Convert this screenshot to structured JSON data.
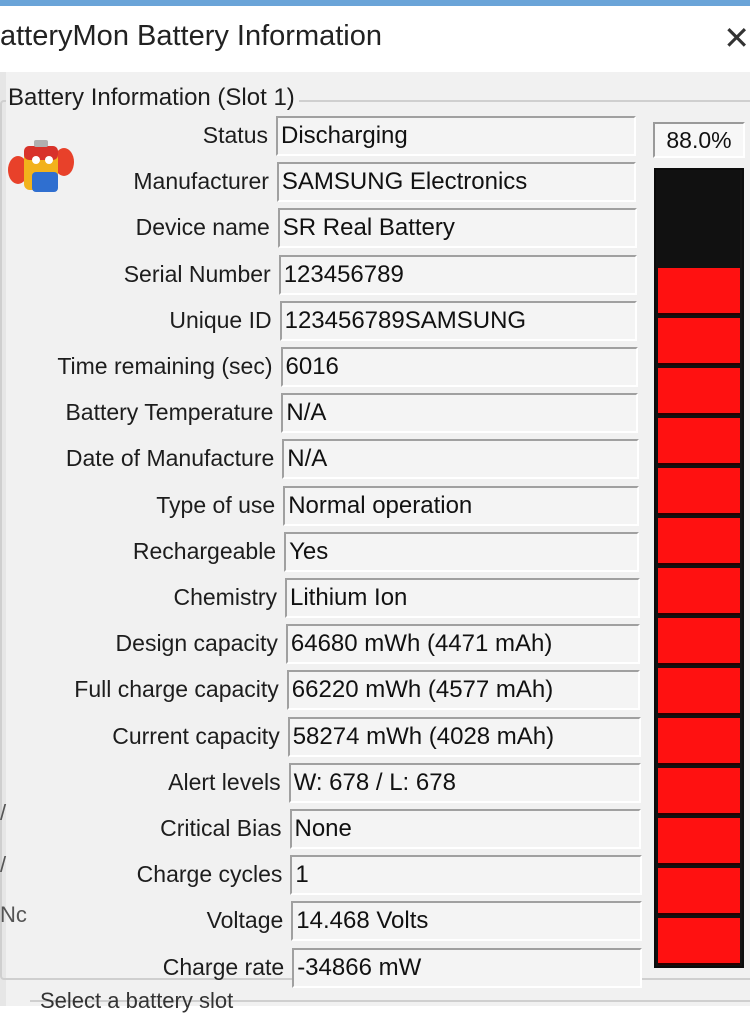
{
  "window": {
    "title": "atteryMon Battery Information",
    "close_glyph": "✕"
  },
  "group": {
    "label": "Battery Information (Slot 1)"
  },
  "icon": "battery-icon",
  "rows": [
    {
      "label": "Status",
      "value": "Discharging"
    },
    {
      "label": "Manufacturer",
      "value": "SAMSUNG Electronics"
    },
    {
      "label": "Device name",
      "value": "SR Real Battery"
    },
    {
      "label": "Serial Number",
      "value": "123456789"
    },
    {
      "label": "Unique ID",
      "value": "123456789SAMSUNG"
    },
    {
      "label": "Time remaining (sec)",
      "value": "6016"
    },
    {
      "label": "Battery Temperature",
      "value": "N/A"
    },
    {
      "label": "Date of Manufacture",
      "value": "N/A"
    },
    {
      "label": "Type of use",
      "value": "Normal operation"
    },
    {
      "label": "Rechargeable",
      "value": "Yes"
    },
    {
      "label": "Chemistry",
      "value": "Lithium Ion"
    },
    {
      "label": "Design capacity",
      "value": "64680 mWh (4471 mAh)"
    },
    {
      "label": "Full charge capacity",
      "value": "66220 mWh (4577 mAh)"
    },
    {
      "label": "Current capacity",
      "value": "58274 mWh (4028 mAh)"
    },
    {
      "label": "Alert levels",
      "value": "W: 678 / L: 678"
    },
    {
      "label": "Critical Bias",
      "value": "None"
    },
    {
      "label": "Charge cycles",
      "value": "1"
    },
    {
      "label": "Voltage",
      "value": "14.468 Volts"
    },
    {
      "label": "Charge rate",
      "value": "-34866 mW"
    }
  ],
  "meter": {
    "percent_text": "88.0%",
    "level": 0.88,
    "segments": 14,
    "fill_color": "#ff1111",
    "empty_color": "#111111"
  },
  "bottom": {
    "text": "Select a battery slot"
  },
  "left_partials": [
    "/",
    "/",
    "Nc"
  ]
}
